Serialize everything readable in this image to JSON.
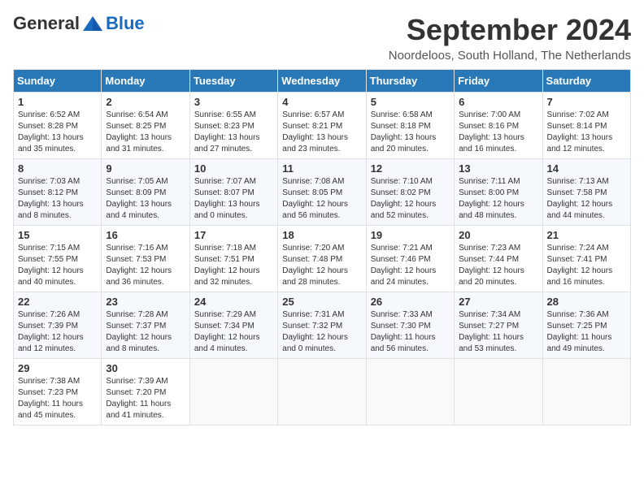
{
  "logo": {
    "general": "General",
    "blue": "Blue"
  },
  "header": {
    "title": "September 2024",
    "subtitle": "Noordeloos, South Holland, The Netherlands"
  },
  "weekdays": [
    "Sunday",
    "Monday",
    "Tuesday",
    "Wednesday",
    "Thursday",
    "Friday",
    "Saturday"
  ],
  "weeks": [
    [
      {
        "day": "1",
        "info": "Sunrise: 6:52 AM\nSunset: 8:28 PM\nDaylight: 13 hours\nand 35 minutes."
      },
      {
        "day": "2",
        "info": "Sunrise: 6:54 AM\nSunset: 8:25 PM\nDaylight: 13 hours\nand 31 minutes."
      },
      {
        "day": "3",
        "info": "Sunrise: 6:55 AM\nSunset: 8:23 PM\nDaylight: 13 hours\nand 27 minutes."
      },
      {
        "day": "4",
        "info": "Sunrise: 6:57 AM\nSunset: 8:21 PM\nDaylight: 13 hours\nand 23 minutes."
      },
      {
        "day": "5",
        "info": "Sunrise: 6:58 AM\nSunset: 8:18 PM\nDaylight: 13 hours\nand 20 minutes."
      },
      {
        "day": "6",
        "info": "Sunrise: 7:00 AM\nSunset: 8:16 PM\nDaylight: 13 hours\nand 16 minutes."
      },
      {
        "day": "7",
        "info": "Sunrise: 7:02 AM\nSunset: 8:14 PM\nDaylight: 13 hours\nand 12 minutes."
      }
    ],
    [
      {
        "day": "8",
        "info": "Sunrise: 7:03 AM\nSunset: 8:12 PM\nDaylight: 13 hours\nand 8 minutes."
      },
      {
        "day": "9",
        "info": "Sunrise: 7:05 AM\nSunset: 8:09 PM\nDaylight: 13 hours\nand 4 minutes."
      },
      {
        "day": "10",
        "info": "Sunrise: 7:07 AM\nSunset: 8:07 PM\nDaylight: 13 hours\nand 0 minutes."
      },
      {
        "day": "11",
        "info": "Sunrise: 7:08 AM\nSunset: 8:05 PM\nDaylight: 12 hours\nand 56 minutes."
      },
      {
        "day": "12",
        "info": "Sunrise: 7:10 AM\nSunset: 8:02 PM\nDaylight: 12 hours\nand 52 minutes."
      },
      {
        "day": "13",
        "info": "Sunrise: 7:11 AM\nSunset: 8:00 PM\nDaylight: 12 hours\nand 48 minutes."
      },
      {
        "day": "14",
        "info": "Sunrise: 7:13 AM\nSunset: 7:58 PM\nDaylight: 12 hours\nand 44 minutes."
      }
    ],
    [
      {
        "day": "15",
        "info": "Sunrise: 7:15 AM\nSunset: 7:55 PM\nDaylight: 12 hours\nand 40 minutes."
      },
      {
        "day": "16",
        "info": "Sunrise: 7:16 AM\nSunset: 7:53 PM\nDaylight: 12 hours\nand 36 minutes."
      },
      {
        "day": "17",
        "info": "Sunrise: 7:18 AM\nSunset: 7:51 PM\nDaylight: 12 hours\nand 32 minutes."
      },
      {
        "day": "18",
        "info": "Sunrise: 7:20 AM\nSunset: 7:48 PM\nDaylight: 12 hours\nand 28 minutes."
      },
      {
        "day": "19",
        "info": "Sunrise: 7:21 AM\nSunset: 7:46 PM\nDaylight: 12 hours\nand 24 minutes."
      },
      {
        "day": "20",
        "info": "Sunrise: 7:23 AM\nSunset: 7:44 PM\nDaylight: 12 hours\nand 20 minutes."
      },
      {
        "day": "21",
        "info": "Sunrise: 7:24 AM\nSunset: 7:41 PM\nDaylight: 12 hours\nand 16 minutes."
      }
    ],
    [
      {
        "day": "22",
        "info": "Sunrise: 7:26 AM\nSunset: 7:39 PM\nDaylight: 12 hours\nand 12 minutes."
      },
      {
        "day": "23",
        "info": "Sunrise: 7:28 AM\nSunset: 7:37 PM\nDaylight: 12 hours\nand 8 minutes."
      },
      {
        "day": "24",
        "info": "Sunrise: 7:29 AM\nSunset: 7:34 PM\nDaylight: 12 hours\nand 4 minutes."
      },
      {
        "day": "25",
        "info": "Sunrise: 7:31 AM\nSunset: 7:32 PM\nDaylight: 12 hours\nand 0 minutes."
      },
      {
        "day": "26",
        "info": "Sunrise: 7:33 AM\nSunset: 7:30 PM\nDaylight: 11 hours\nand 56 minutes."
      },
      {
        "day": "27",
        "info": "Sunrise: 7:34 AM\nSunset: 7:27 PM\nDaylight: 11 hours\nand 53 minutes."
      },
      {
        "day": "28",
        "info": "Sunrise: 7:36 AM\nSunset: 7:25 PM\nDaylight: 11 hours\nand 49 minutes."
      }
    ],
    [
      {
        "day": "29",
        "info": "Sunrise: 7:38 AM\nSunset: 7:23 PM\nDaylight: 11 hours\nand 45 minutes."
      },
      {
        "day": "30",
        "info": "Sunrise: 7:39 AM\nSunset: 7:20 PM\nDaylight: 11 hours\nand 41 minutes."
      },
      {
        "day": "",
        "info": ""
      },
      {
        "day": "",
        "info": ""
      },
      {
        "day": "",
        "info": ""
      },
      {
        "day": "",
        "info": ""
      },
      {
        "day": "",
        "info": ""
      }
    ]
  ]
}
